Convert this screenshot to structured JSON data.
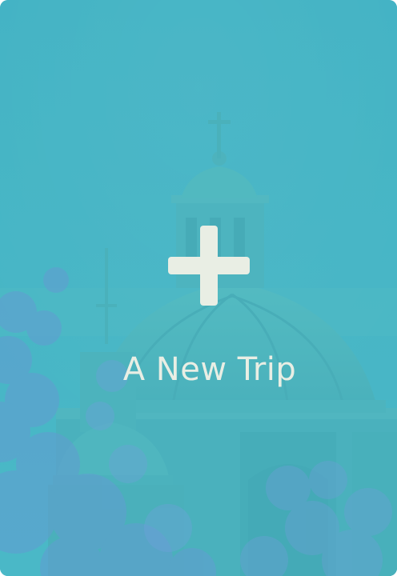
{
  "card": {
    "label": "A New Trip",
    "icon": "plus-icon",
    "colors": {
      "tint": "#4fb8c6",
      "foreground": "#e9eee4",
      "foliage": "#6f8fd8"
    }
  }
}
